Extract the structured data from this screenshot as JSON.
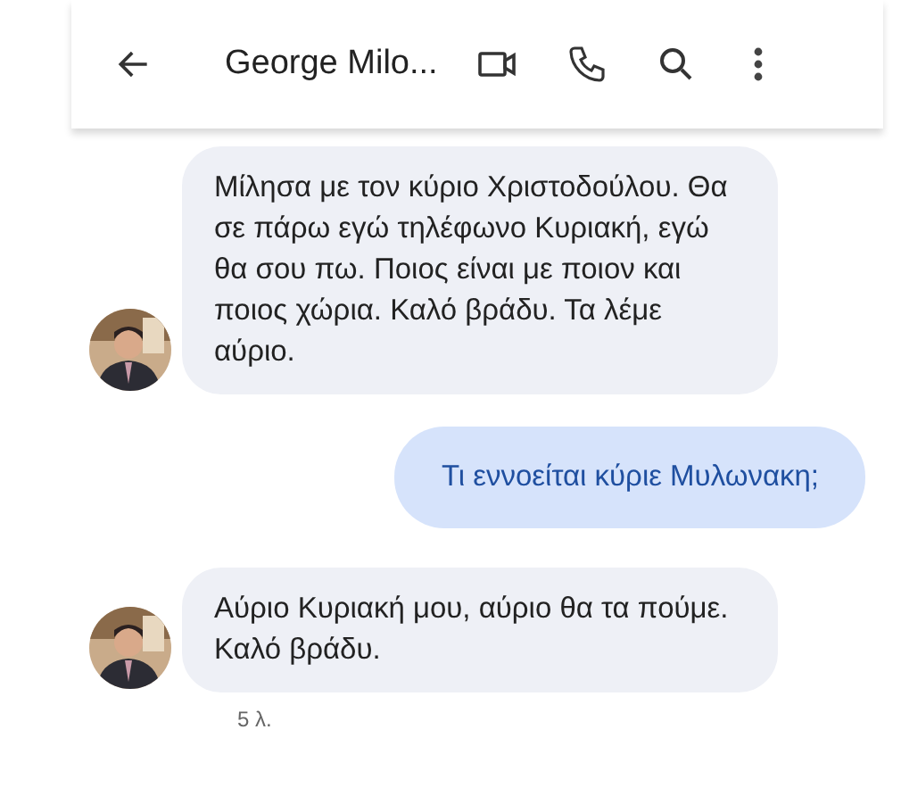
{
  "header": {
    "title": "George Milo..."
  },
  "messages": [
    {
      "kind": "received",
      "text": "Μίλησα με τον κύριο Χριστοδούλου. Θα σε πάρω εγώ τηλέφωνο Κυριακή, εγώ θα σου πω. Ποιος είναι με ποιον και ποιος χώρια. Καλό βράδυ. Τα λέμε αύριο."
    },
    {
      "kind": "sent",
      "text": "Τι εννοείται κύριε Μυλωνακη;"
    },
    {
      "kind": "received",
      "text": "Αύριο Κυριακή μου, αύριο θα τα πούμε. Καλό βράδυ.",
      "time": "5 λ."
    }
  ]
}
